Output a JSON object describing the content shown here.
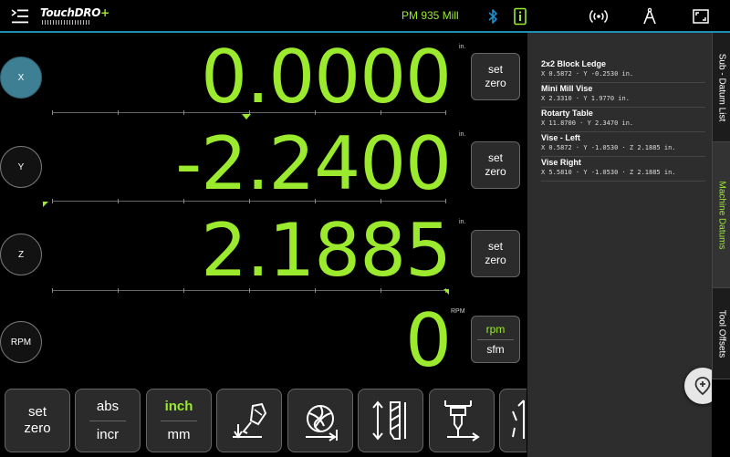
{
  "header": {
    "logo": {
      "part1": "Touch",
      "part2": "DRO",
      "plus": "+"
    },
    "machine_name": "PM 935 Mill",
    "icons": [
      "menu-icon",
      "bluetooth-icon",
      "info-icon",
      "signal-icon",
      "compass-icon",
      "fullscreen-icon"
    ],
    "accent_color": "#9bea2e",
    "bar_color": "#1f8fb4"
  },
  "axes": [
    {
      "label": "X",
      "value": "0.0000",
      "unit": "in.",
      "button": [
        "set",
        "zero"
      ]
    },
    {
      "label": "Y",
      "value": "-2.2400",
      "unit": "in.",
      "button": [
        "set",
        "zero"
      ]
    },
    {
      "label": "Z",
      "value": "2.1885",
      "unit": "in.",
      "button": [
        "set",
        "zero"
      ]
    },
    {
      "label": "RPM",
      "value": "0",
      "unit": "RPM",
      "button": [
        "rpm",
        "sfm"
      ]
    }
  ],
  "toolbar": {
    "set_zero": [
      "set",
      "zero"
    ],
    "abs_incr": [
      "abs",
      "incr"
    ],
    "inch_mm": [
      "inch",
      "mm"
    ],
    "icons": [
      "probe-edge-icon",
      "end-mill-icon",
      "tool-length-icon",
      "drill-center-icon",
      "partial-tool-icon"
    ]
  },
  "panel": {
    "datums": [
      {
        "name": "2x2 Block Ledge",
        "coords": "X 0.5872 · Y -0.2530 in."
      },
      {
        "name": "Mini Mill Vise",
        "coords": "X 2.3310 · Y 1.9770 in."
      },
      {
        "name": "Rotarty Table",
        "coords": "X 11.8700 · Y 2.3470 in."
      },
      {
        "name": "Vise - Left",
        "coords": "X 0.5872 · Y -1.0530 · Z 2.1885 in."
      },
      {
        "name": "Vise Right",
        "coords": "X 5.5810 · Y -1.0530 · Z 2.1885 in."
      }
    ],
    "tabs": [
      "Sub - Datum List",
      "Machine Datums",
      "Tool Offsets"
    ],
    "active_tab": "Machine Datums",
    "fab_icon": "add-location-icon"
  }
}
